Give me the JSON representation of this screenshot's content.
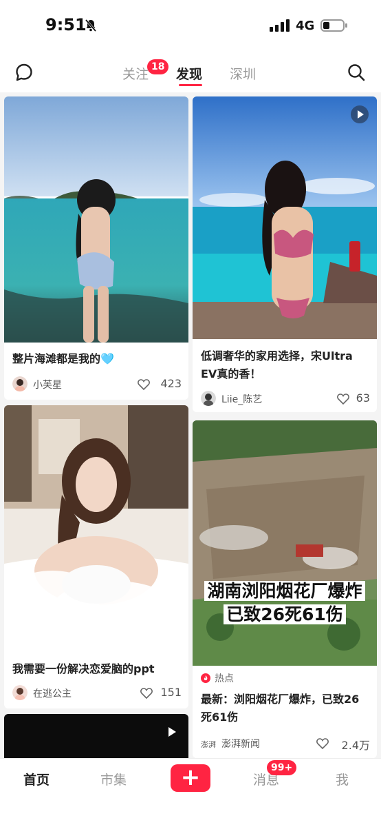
{
  "status_bar": {
    "time": "9:51",
    "network": "4G"
  },
  "top_nav": {
    "tabs": [
      {
        "label": "关注",
        "badge": "18"
      },
      {
        "label": "发现"
      },
      {
        "label": "深圳"
      }
    ]
  },
  "feed": {
    "cards": [
      {
        "title": "整片海滩都是我的🩵",
        "author": "小芙星",
        "likes": "423",
        "image": "woman standing in tropical sea"
      },
      {
        "title": "低调奢华的家用选择，宋Ultra EV真的香！",
        "author": "Liie_陈艺",
        "likes": "63",
        "image": "woman in leopard bikini by pool"
      },
      {
        "title": "我需要一份解决恋爱脑的ppt",
        "author": "在逃公主",
        "likes": "151",
        "image": "woman in bubble bath"
      },
      {
        "tag": "热点",
        "overlay_line1": "湖南浏阳烟花厂爆炸",
        "overlay_line2": "已致26死61伤",
        "title": "最新：浏阳烟花厂爆炸，已致26死61伤",
        "author": "澎湃新闻",
        "likes": "2.4万",
        "image": "aerial view of explosion site"
      },
      {
        "image": "dark video thumbnail"
      }
    ]
  },
  "bottom_nav": {
    "home": "首页",
    "market": "市集",
    "add": "+",
    "messages": "消息",
    "messages_badge": "99+",
    "me": "我"
  },
  "colors": {
    "accent": "#ff2442"
  }
}
